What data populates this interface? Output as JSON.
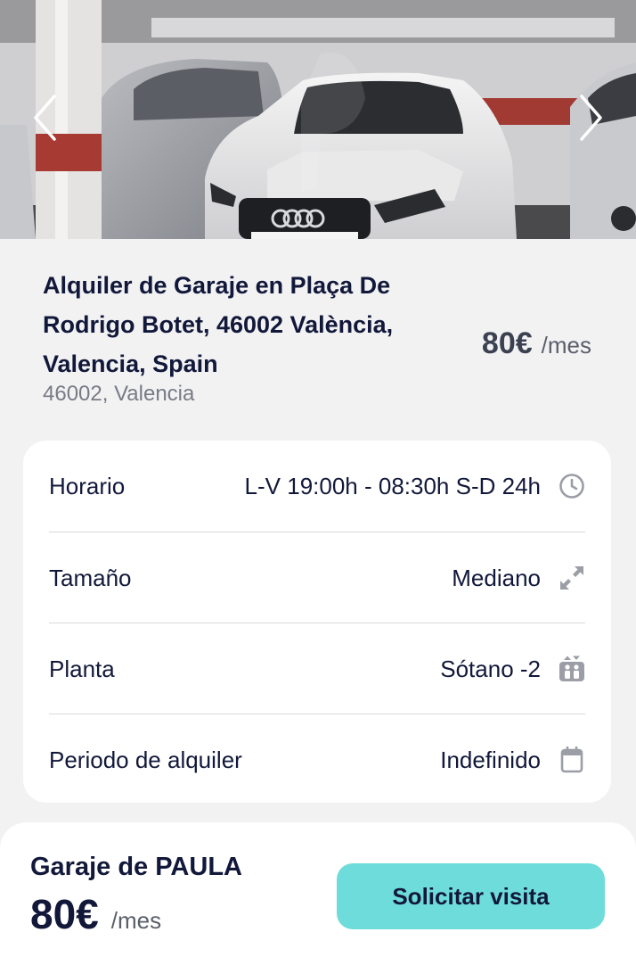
{
  "hero": {
    "icons": {
      "prev": "chevron-left-icon",
      "next": "chevron-right-icon"
    }
  },
  "listing": {
    "title": "Alquiler de Garaje en Plaça De Rodrigo Botet, 46002 València, Valencia, Spain",
    "subtitle": "46002, Valencia",
    "price": "80€",
    "price_unit": "/mes"
  },
  "details": [
    {
      "label": "Horario",
      "value": "L-V 19:00h - 08:30h S-D 24h",
      "icon": "clock-icon"
    },
    {
      "label": "Tamaño",
      "value": "Mediano",
      "icon": "expand-arrows-icon"
    },
    {
      "label": "Planta",
      "value": "Sótano -2",
      "icon": "elevator-icon"
    },
    {
      "label": "Periodo de alquiler",
      "value": "Indefinido",
      "icon": "calendar-icon"
    }
  ],
  "footer": {
    "owner": "Garaje de PAULA",
    "price": "80€",
    "price_unit": "/mes",
    "cta_label": "Solicitar visita"
  },
  "colors": {
    "accent": "#6edcdb",
    "text_primary": "#12183a",
    "text_secondary": "#787b86",
    "page_bg": "#f2f2f3"
  }
}
